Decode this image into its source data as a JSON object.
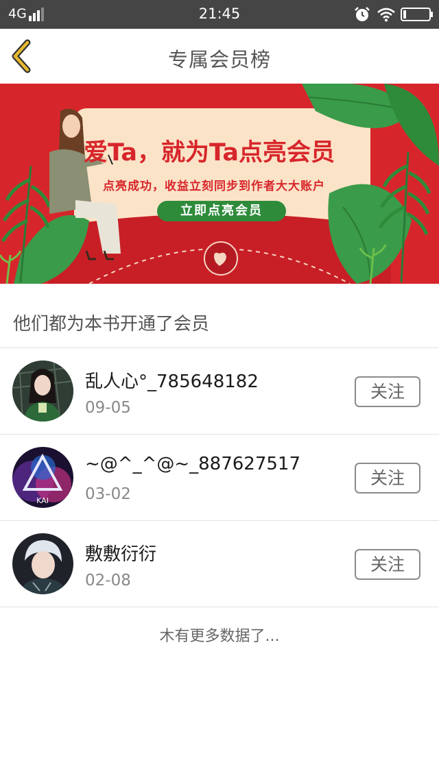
{
  "status_bar": {
    "carrier": "4G",
    "time": "21:45",
    "icons": [
      "signal-icon",
      "alarm-icon",
      "wifi-icon",
      "battery-icon"
    ]
  },
  "nav": {
    "back_icon": "chevron-left-icon",
    "title": "专属会员榜"
  },
  "banner": {
    "headline": "爱Ta，就为Ta点亮会员",
    "subtitle": "点亮成功，收益立刻同步到作者大大账户",
    "cta_label": "立即点亮会员"
  },
  "section": {
    "title": "他们都为本书开通了会员"
  },
  "members": [
    {
      "name": "乱人心°_785648182",
      "date": "09-05",
      "follow_label": "关注"
    },
    {
      "name": "~@^_^@~_887627517",
      "date": "03-02",
      "follow_label": "关注"
    },
    {
      "name": "敷敷衍衍",
      "date": "02-08",
      "follow_label": "关注"
    }
  ],
  "footer": {
    "text": "木有更多数据了..."
  },
  "colors": {
    "status_bar_bg": "#454545",
    "banner_red": "#d7262b",
    "banner_green": "#2e8b3a",
    "accent_yellow": "#e6b82e"
  }
}
